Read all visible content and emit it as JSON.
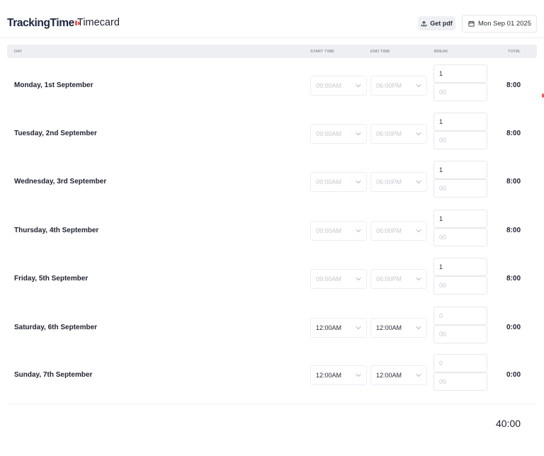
{
  "header": {
    "logo_text": "TrackingTime",
    "title": "Timecard",
    "get_pdf_label": "Get pdf",
    "date_label": "Mon Sep 01 2025"
  },
  "table": {
    "columns": {
      "day": "DAY",
      "start": "START TIME",
      "end": "END TIME",
      "break": "BREAK",
      "total": "TOTAL"
    },
    "rows": [
      {
        "day": "Monday, 1st September",
        "start": "09:00AM",
        "end": "06:00PM",
        "break_hours": "1",
        "break_minutes": "00",
        "total": "8:00",
        "state": "dim"
      },
      {
        "day": "Tuesday, 2nd September",
        "start": "09:00AM",
        "end": "06:00PM",
        "break_hours": "1",
        "break_minutes": "00",
        "total": "8:00",
        "state": "dim"
      },
      {
        "day": "Wednesday, 3rd September",
        "start": "09:00AM",
        "end": "06:00PM",
        "break_hours": "1",
        "break_minutes": "00",
        "total": "8:00",
        "state": "dim"
      },
      {
        "day": "Thursday, 4th September",
        "start": "09:00AM",
        "end": "06:00PM",
        "break_hours": "1",
        "break_minutes": "00",
        "total": "8:00",
        "state": "dim"
      },
      {
        "day": "Friday, 5th September",
        "start": "09:00AM",
        "end": "06:00PM",
        "break_hours": "1",
        "break_minutes": "00",
        "total": "8:00",
        "state": "dim"
      },
      {
        "day": "Saturday, 6th September",
        "start": "12:00AM",
        "end": "12:00AM",
        "break_hours": "0",
        "break_minutes": "00",
        "total": "0:00",
        "state": "active"
      },
      {
        "day": "Sunday, 7th September",
        "start": "12:00AM",
        "end": "12:00AM",
        "break_hours": "0",
        "break_minutes": "00",
        "total": "0:00",
        "state": "active"
      }
    ]
  },
  "grand_total": "40:00",
  "icons": {
    "pdf": "upload-icon",
    "date": "calendar-icon",
    "select": "chevron-down-icon"
  },
  "colors": {
    "brand_accent": "#ef5b5b",
    "brand_text": "#1c2540",
    "header_bg": "#edeff2"
  }
}
